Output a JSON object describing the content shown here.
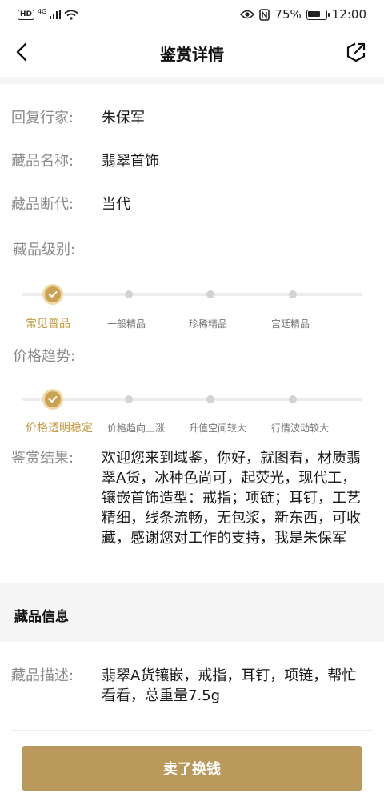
{
  "status_bar": {
    "hd": "HD",
    "network": "4G",
    "battery_text": "75%",
    "battery_level": 0.75,
    "time": "12:00"
  },
  "header": {
    "title": "鉴赏详情",
    "back_icon": "chevron-left-icon",
    "share_icon": "share-icon"
  },
  "details": {
    "expert": {
      "label": "回复行家:",
      "value": "朱保军"
    },
    "name": {
      "label": "藏品名称:",
      "value": "翡翠首饰"
    },
    "era": {
      "label": "藏品断代:",
      "value": "当代"
    }
  },
  "grade": {
    "label": "藏品级别:",
    "options": [
      "常见普品",
      "一般精品",
      "珍稀精品",
      "宫廷精品"
    ],
    "selected": "常见普品"
  },
  "trend": {
    "label": "价格趋势:",
    "options": [
      "价格透明稳定",
      "价格趋向上涨",
      "升值空间较大",
      "行情波动较大"
    ],
    "selected": "价格透明稳定"
  },
  "result": {
    "label": "鉴赏结果:",
    "text": "欢迎您来到域鉴，你好，就图看，材质翡翠A货，冰种色尚可，起荧光，现代工，镶嵌首饰造型：戒指；项链；耳钉，工艺精细，线条流畅，无包浆，新东西，可收藏，感谢您对工作的支持，我是朱保军"
  },
  "info": {
    "title": "藏品信息",
    "desc_label": "藏品描述:",
    "desc_value": "翡翠A货镶嵌，戒指，耳钉，项链，帮忙看看，总重量7.5g"
  },
  "action": {
    "sell_label": "卖了换钱"
  },
  "colors": {
    "accent": "#c9a253",
    "button": "#b99a5c",
    "label": "#8a8a8a"
  }
}
